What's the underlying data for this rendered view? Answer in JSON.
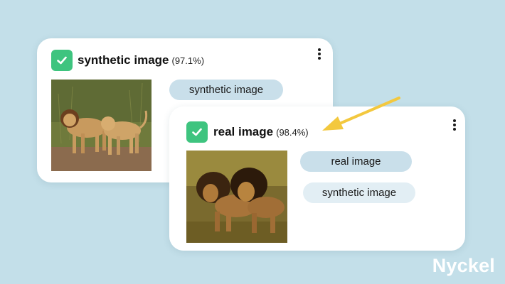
{
  "cards": [
    {
      "title": "synthetic image",
      "confidence": "(97.1%)",
      "image": "two-lionesses-standing-photo",
      "labels": [
        {
          "text": "synthetic image",
          "selected": true
        }
      ]
    },
    {
      "title": "real image",
      "confidence": "(98.4%)",
      "image": "two-male-lions-walking-photo",
      "labels": [
        {
          "text": "real image",
          "selected": true
        },
        {
          "text": "synthetic image",
          "selected": false
        }
      ]
    }
  ],
  "icons": {
    "check": "checkmark-icon",
    "menu": "more-vertical-icon",
    "arrow": "arrow-icon"
  },
  "colors": {
    "background": "#c3dfe9",
    "check_green": "#3ec47f",
    "label_selected": "#c9dfea",
    "label_option": "#e2eef4",
    "arrow": "#f3c83e"
  },
  "brand": "Nyckel"
}
